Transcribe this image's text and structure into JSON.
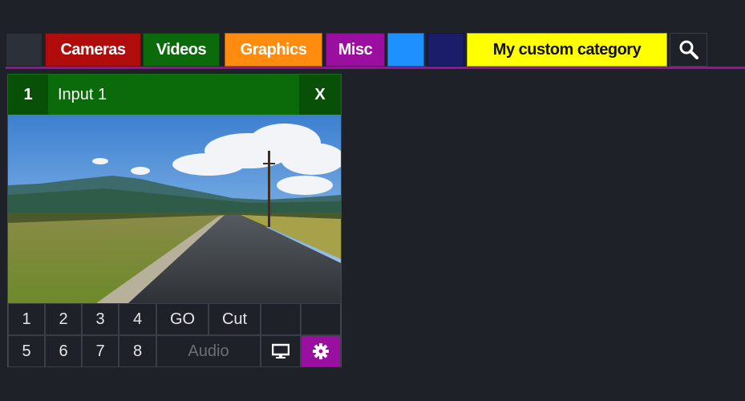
{
  "colors": {
    "background": "#1e2228",
    "accent_misc": "#9b0fa0",
    "input_header": "#0b6b0b"
  },
  "tabs": [
    {
      "label": "",
      "bg": "#2c3038",
      "color": "#ffffff"
    },
    {
      "label": "Cameras",
      "bg": "#b10c0c",
      "color": "#ffffff"
    },
    {
      "label": "Videos",
      "bg": "#0b6b0b",
      "color": "#ffffff"
    },
    {
      "label": "Graphics",
      "bg": "#ff8c0f",
      "color": "#ffffff"
    },
    {
      "label": "Misc",
      "bg": "#9b0fa0",
      "color": "#ffffff"
    },
    {
      "label": "",
      "bg": "#1e90ff",
      "color": "#ffffff"
    },
    {
      "label": "",
      "bg": "#1b1c6a",
      "color": "#ffffff"
    },
    {
      "label": "My custom category",
      "bg": "#ffff00",
      "color": "#111111"
    }
  ],
  "search": {
    "icon": "search-icon"
  },
  "input": {
    "number": "1",
    "name": "Input 1",
    "close": "X"
  },
  "buttons": {
    "row1": [
      "1",
      "2",
      "3",
      "4",
      "GO",
      "Cut"
    ],
    "row2": [
      "5",
      "6",
      "7",
      "8"
    ],
    "audio": "Audio",
    "monitor_icon": "monitor-icon",
    "settings_icon": "gear-icon"
  }
}
